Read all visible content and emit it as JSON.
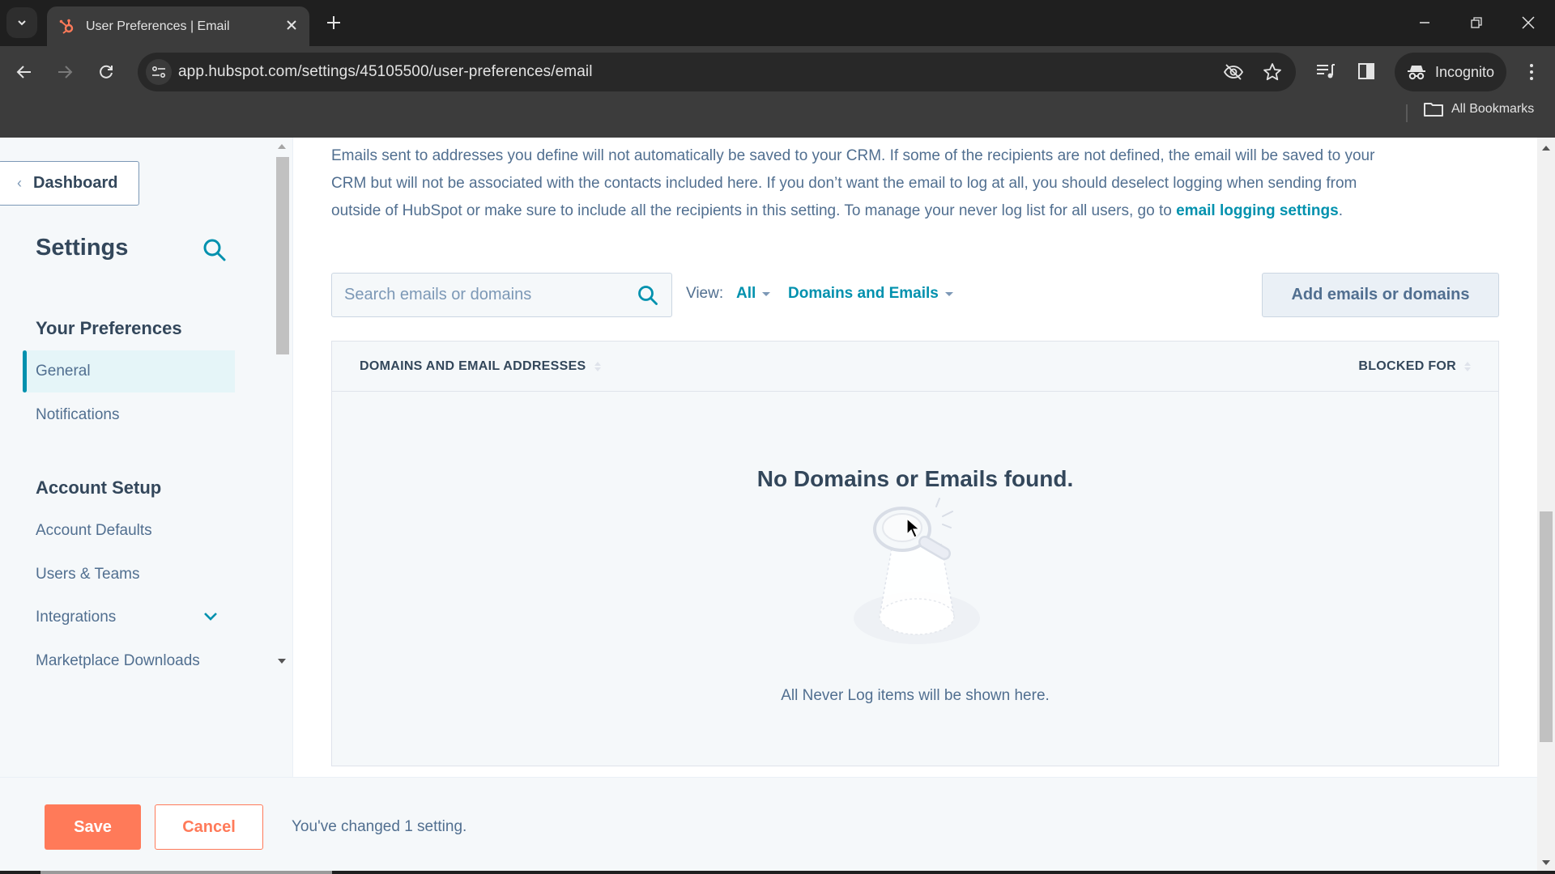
{
  "browser": {
    "tab_title": "User Preferences | Email",
    "url": "app.hubspot.com/settings/45105500/user-preferences/email",
    "incognito_label": "Incognito",
    "bookmarks_label": "All Bookmarks",
    "icons": [
      "tab-list-icon",
      "hubspot-favicon",
      "close-icon",
      "plus-icon",
      "back-icon",
      "forward-icon",
      "reload-icon",
      "site-info-icon",
      "eye-off-icon",
      "star-icon",
      "media-icon",
      "side-panel-icon",
      "incognito-icon",
      "more-vert-icon",
      "folder-icon",
      "minimize-icon",
      "restore-icon",
      "window-close-icon"
    ]
  },
  "sidebar": {
    "back_button": "Dashboard",
    "title": "Settings",
    "sections": [
      {
        "heading": "Your Preferences",
        "items": [
          {
            "label": "General",
            "active": true
          },
          {
            "label": "Notifications",
            "active": false
          }
        ]
      },
      {
        "heading": "Account Setup",
        "items": [
          {
            "label": "Account Defaults",
            "active": false
          },
          {
            "label": "Users & Teams",
            "active": false
          },
          {
            "label": "Integrations",
            "active": false,
            "expandable": true
          },
          {
            "label": "Marketplace Downloads",
            "active": false
          }
        ]
      }
    ]
  },
  "main": {
    "intro_text": "Emails sent to addresses you define will not automatically be saved to your CRM. If some of the recipients are not defined, the email will be saved to your CRM but will not be associated with the contacts included here. If you don’t want the email to log at all, you should deselect logging when sending from outside of HubSpot or make sure to include all the recipients in this setting. To manage your never log list for all users, go to ",
    "intro_link": "email logging settings",
    "intro_end": ".",
    "search_placeholder": "Search emails or domains",
    "search_value": "",
    "view_label": "View:",
    "view_filter": "All",
    "type_filter": "Domains and Emails",
    "add_button": "Add emails or domains",
    "table": {
      "columns": [
        "DOMAINS AND EMAIL ADDRESSES",
        "BLOCKED FOR"
      ],
      "rows": []
    },
    "empty_title": "No Domains or Emails found.",
    "empty_subtitle": "All Never Log items will be shown here."
  },
  "footer": {
    "save_label": "Save",
    "cancel_label": "Cancel",
    "status": "You've changed 1 setting."
  },
  "colors": {
    "accent": "#0091ae",
    "primary_button": "#ff7a59",
    "text": "#33475b",
    "muted_text": "#516f90"
  }
}
